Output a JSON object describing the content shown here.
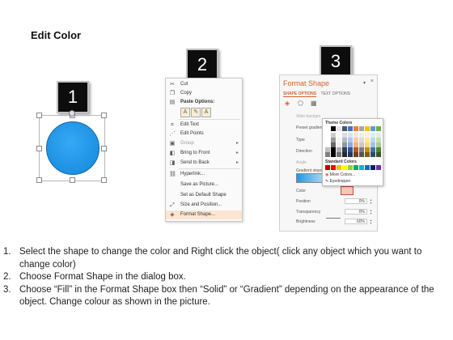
{
  "title": "Edit Color",
  "badges": [
    "1",
    "2",
    "3"
  ],
  "menu": {
    "items": [
      {
        "label": "Cut",
        "icon": "cut-icon"
      },
      {
        "label": "Copy",
        "icon": "copy-icon"
      },
      {
        "label": "Paste Options:",
        "icon": "paste-icon"
      },
      {
        "label": "Edit Text",
        "icon": "edit-text-icon"
      },
      {
        "label": "Edit Points",
        "icon": "edit-points-icon"
      },
      {
        "label": "Group",
        "icon": "group-icon",
        "submenu": "▸"
      },
      {
        "label": "Bring to Front",
        "icon": "bring-front-icon",
        "submenu": "▸"
      },
      {
        "label": "Send to Back",
        "icon": "send-back-icon",
        "submenu": "▸"
      },
      {
        "label": "Hyperlink...",
        "icon": "hyperlink-icon"
      },
      {
        "label": "Save as Picture..."
      },
      {
        "label": "Set as Default Shape"
      },
      {
        "label": "Size and Position...",
        "icon": "size-icon"
      },
      {
        "label": "Format Shape...",
        "icon": "format-shape-icon"
      }
    ]
  },
  "pane": {
    "title": "Format Shape",
    "close": "×",
    "tab_active": "SHAPE OPTIONS",
    "tab_other": "TEXT OPTIONS",
    "slide_bg": "Slide backgro",
    "preset": "Preset gradien",
    "type": "Type",
    "direction": "Direction",
    "angle": "Angle",
    "gradient_stops": "Gradient stops",
    "color": "Color",
    "position": "Position",
    "position_val": "0%",
    "transparency": "Transparency",
    "transparency_val": "0%",
    "brightness": "Brightness",
    "brightness_val": "60%"
  },
  "color_popup": {
    "theme_header": "Theme Colors",
    "standard_header": "Standard Colors",
    "more_colors": "More Colors...",
    "eyedropper": "Eyedropper",
    "theme_top": [
      "#ffffff",
      "#000000",
      "#e7e6e6",
      "#44546a",
      "#4472c4",
      "#ed7d31",
      "#a5a5a5",
      "#ffc000",
      "#5b9bd5",
      "#70ad47"
    ],
    "standard": [
      "#c00000",
      "#ff0000",
      "#ffc000",
      "#ffff00",
      "#92d050",
      "#00b050",
      "#00b0f0",
      "#0070c0",
      "#002060",
      "#7030a0"
    ]
  },
  "instructions": [
    {
      "num": "1.",
      "text": "Select the shape to change the color and Right click the object( click any object which you want to change color)"
    },
    {
      "num": "2.",
      "text": "Choose Format Shape in the dialog box."
    },
    {
      "num": "3.",
      "text": "Choose “Fill” in the Format Shape box then “Solid” or “Gradient” depending on the appearance of the object. Change colour as shown in the picture."
    }
  ]
}
